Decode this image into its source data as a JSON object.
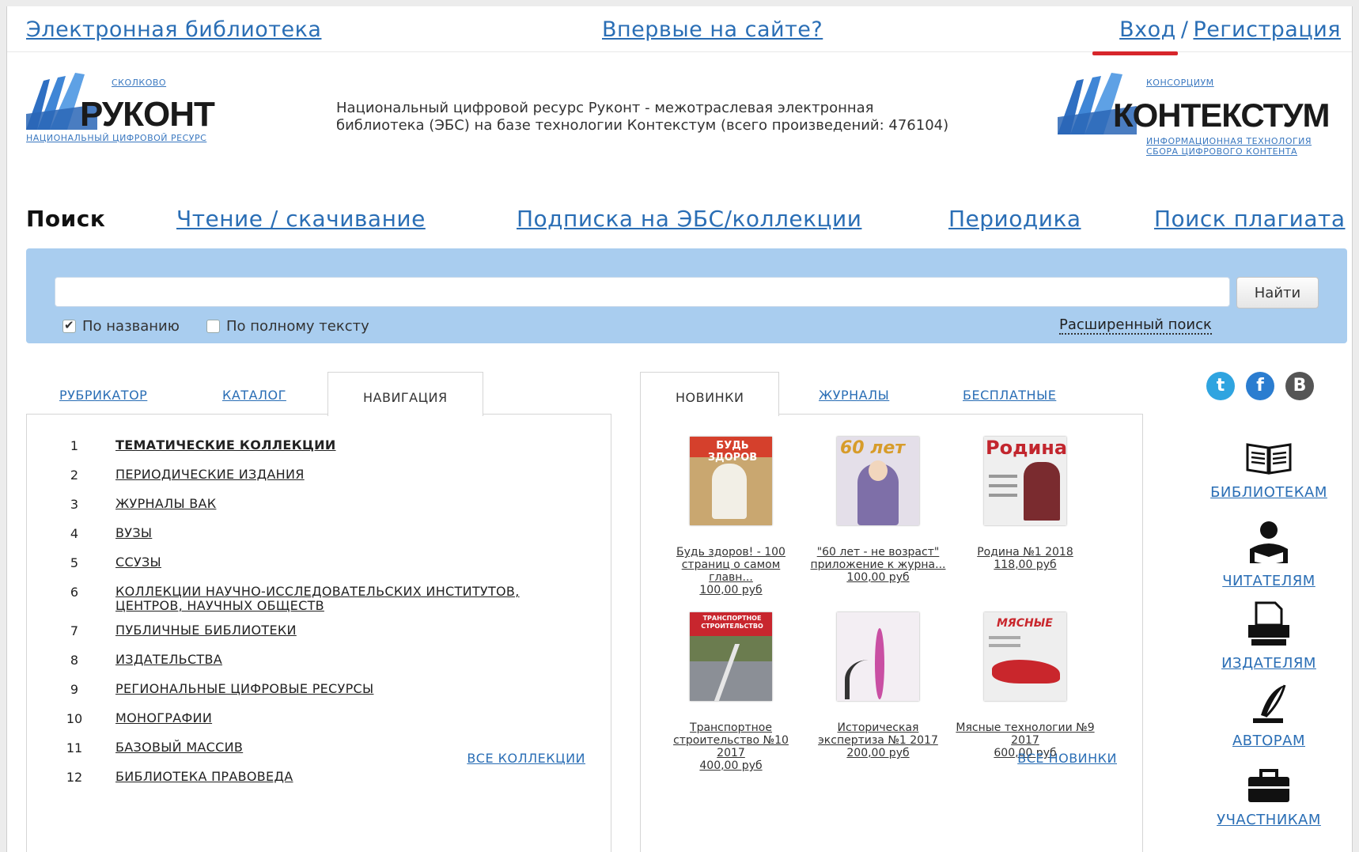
{
  "topbar": {
    "library_link": "Электронная библиотека",
    "first_time_link": "Впервые на сайте?",
    "login_link": "Вход",
    "separator": "/",
    "register_link": "Регистрация"
  },
  "logos": {
    "rukont": {
      "top_small": "СКОЛКОВО",
      "name": "РУКОНТ",
      "subtitle": "НАЦИОНАЛЬНЫЙ ЦИФРОВОЙ РЕСУРС"
    },
    "kontextum": {
      "top_small": "КОНСОРЦИУМ",
      "name": "КОНТЕКСТУМ",
      "subtitle_line1": "ИНФОРМАЦИОННАЯ ТЕХНОЛОГИЯ",
      "subtitle_line2": "СБОРА ЦИФРОВОГО КОНТЕНТА"
    }
  },
  "description": "Национальный цифровой ресурс Руконт - межотраслевая электронная библиотека (ЭБС) на базе технологии Контекстум (всего произведений: 476104)",
  "main_nav": [
    {
      "label": "Поиск",
      "active": true
    },
    {
      "label": "Чтение / скачивание",
      "active": false
    },
    {
      "label": "Подписка на ЭБС/коллекции",
      "active": false
    },
    {
      "label": "Периодика",
      "active": false
    },
    {
      "label": "Поиск плагиата",
      "active": false
    }
  ],
  "search": {
    "value": "",
    "button_label": "Найти",
    "by_title_label": "По названию",
    "by_title_checked": true,
    "by_fulltext_label": "По полному тексту",
    "by_fulltext_checked": false,
    "advanced_label": "Расширенный поиск"
  },
  "left_tabs": [
    {
      "label": "РУБРИКАТОР",
      "active": false
    },
    {
      "label": "КАТАЛОГ",
      "active": false
    },
    {
      "label": "НАВИГАЦИЯ",
      "active": true
    }
  ],
  "collections": [
    {
      "num": "1",
      "label": "ТЕМАТИЧЕСКИЕ КОЛЛЕКЦИИ",
      "bold": true
    },
    {
      "num": "2",
      "label": "ПЕРИОДИЧЕСКИЕ ИЗДАНИЯ"
    },
    {
      "num": "3",
      "label": "ЖУРНАЛЫ ВАК"
    },
    {
      "num": "4",
      "label": "ВУЗЫ"
    },
    {
      "num": "5",
      "label": "ССУЗЫ"
    },
    {
      "num": "6",
      "label": "КОЛЛЕКЦИИ НАУЧНО-ИССЛЕДОВАТЕЛЬСКИХ ИНСТИТУТОВ, ЦЕНТРОВ, НАУЧНЫХ ОБЩЕСТВ"
    },
    {
      "num": "7",
      "label": "ПУБЛИЧНЫЕ БИБЛИОТЕКИ"
    },
    {
      "num": "8",
      "label": "ИЗДАТЕЛЬСТВА"
    },
    {
      "num": "9",
      "label": "РЕГИОНАЛЬНЫЕ ЦИФРОВЫЕ РЕСУРСЫ"
    },
    {
      "num": "10",
      "label": "МОНОГРАФИИ"
    },
    {
      "num": "11",
      "label": "БАЗОВЫЙ МАССИВ"
    },
    {
      "num": "12",
      "label": "БИБЛИОТЕКА ПРАВОВЕДА"
    }
  ],
  "all_collections_link": "ВСЕ КОЛЛЕКЦИИ",
  "mid_tabs": [
    {
      "label": "НОВИНКИ",
      "active": true
    },
    {
      "label": "ЖУРНАЛЫ",
      "active": false
    },
    {
      "label": "БЕСПЛАТНЫЕ",
      "active": false
    }
  ],
  "new_books": [
    {
      "title": "Будь здоров! - 100 страниц о самом главн...",
      "price": "100,00 руб",
      "cover_title": "БУДЬ ЗДОРОВ",
      "cover_bg": "#c9a770",
      "cover_band": "#d5402c"
    },
    {
      "title": "\"60 лет - не возраст\" приложение к журна...",
      "price": "100,00 руб",
      "cover_title": "60 лет",
      "cover_bg": "#7e6fa8",
      "cover_band": "#e4dfe9"
    },
    {
      "title": "Родина №1 2018",
      "price": "118,00 руб",
      "cover_title": "Родина",
      "cover_bg": "#efefef",
      "cover_band": "#c2262e"
    },
    {
      "title": "Транспортное строительство №10 2017",
      "price": "400,00 руб",
      "cover_title": "ТРАНСПОРТНОЕ СТРОИТЕЛЬСТВО",
      "cover_bg": "#6b7c4f",
      "cover_band": "#c8262e"
    },
    {
      "title": "Историческая экспертиза №1 2017",
      "price": "200,00 руб",
      "cover_title": "",
      "cover_bg": "#f3eef3",
      "cover_band": "#c94fa3"
    },
    {
      "title": "Мясные технологии №9 2017",
      "price": "600,00 руб",
      "cover_title": "МЯСНЫЕ",
      "cover_bg": "#eeeeee",
      "cover_band": "#c9262c"
    }
  ],
  "all_new_link": "ВСЕ НОВИНКИ",
  "social": [
    {
      "name": "twitter",
      "glyph": "t",
      "color": "#2fa4e0"
    },
    {
      "name": "facebook",
      "glyph": "f",
      "color": "#2b7dd0"
    },
    {
      "name": "vkontakte",
      "glyph": "В",
      "color": "#555555"
    }
  ],
  "audience_links": [
    {
      "icon": "book-icon",
      "label": "БИБЛИОТЕКАМ"
    },
    {
      "icon": "reader-icon",
      "label": "ЧИТАТЕЛЯМ"
    },
    {
      "icon": "printer-icon",
      "label": "ИЗДАТЕЛЯМ"
    },
    {
      "icon": "quill-icon",
      "label": "АВТОРАМ"
    },
    {
      "icon": "briefcase-icon",
      "label": "УЧАСТНИКАМ"
    }
  ]
}
